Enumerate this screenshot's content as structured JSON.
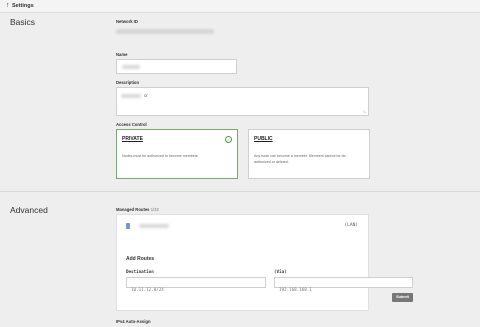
{
  "topbar": {
    "arrow_icon": "arrow-up-icon",
    "title": "Settings"
  },
  "basics": {
    "section_title": "Basics",
    "network_id_label": "Network ID",
    "name_label": "Name",
    "description_label": "Description",
    "description_value_suffix": "cr",
    "access_control_label": "Access Control",
    "private": {
      "title": "PRIVATE",
      "description": "Nodes must be authorized to become members",
      "selected": true
    },
    "public": {
      "title": "PUBLIC",
      "description": "Any node can become a member. Members cannot be de-authorized or deleted."
    }
  },
  "advanced": {
    "section_title": "Advanced",
    "managed_routes_label": "Managed Routes",
    "managed_routes_count": "1/32",
    "route_tag": "(LAN)",
    "add_routes_title": "Add Routes",
    "destination_label": "Destination",
    "destination_placeholder": "10.11.12.0/24",
    "via_label": "(Via)",
    "via_placeholder": "192.168.168.1",
    "submit_label": "Submit",
    "ipv4_label": "IPv4 Auto-Assign"
  },
  "colors": {
    "accent_selected": "#7aa86b",
    "check": "#4c9b46",
    "submit_bg": "#777777"
  }
}
